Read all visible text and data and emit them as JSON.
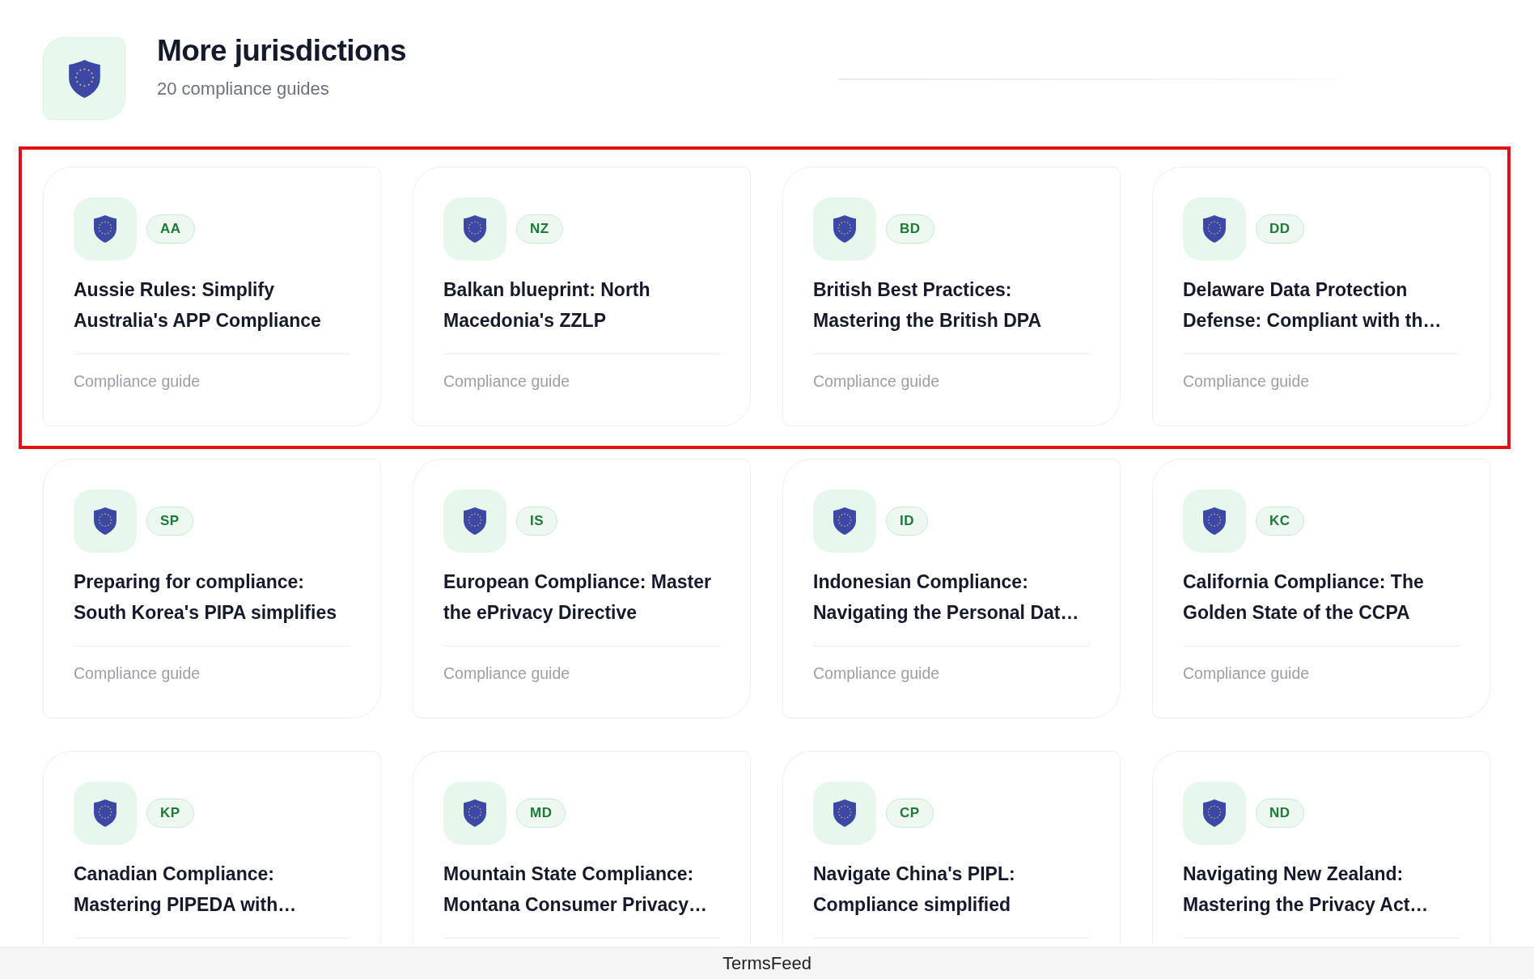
{
  "header": {
    "title": "More jurisdictions",
    "subtitle": "20 compliance guides"
  },
  "card_rows": [
    {
      "highlighted": true,
      "cards": [
        {
          "code": "AA",
          "title": "Aussie Rules: Simplify Australia's APP Compliance",
          "category": "Compliance guide"
        },
        {
          "code": "NZ",
          "title": "Balkan blueprint: North Macedonia's ZZLP",
          "category": "Compliance guide"
        },
        {
          "code": "BD",
          "title": "British Best Practices: Mastering the British DPA",
          "category": "Compliance guide"
        },
        {
          "code": "DD",
          "title": "Delaware Data Protection Defense: Compliant with th…",
          "category": "Compliance guide"
        }
      ]
    },
    {
      "highlighted": false,
      "cards": [
        {
          "code": "SP",
          "title": "Preparing for compliance: South Korea's PIPA simplifies",
          "category": "Compliance guide"
        },
        {
          "code": "IS",
          "title": "European Compliance: Master the ePrivacy Directive",
          "category": "Compliance guide"
        },
        {
          "code": "ID",
          "title": "Indonesian Compliance: Navigating the Personal Dat…",
          "category": "Compliance guide"
        },
        {
          "code": "KC",
          "title": "California Compliance: The Golden State of the CCPA",
          "category": "Compliance guide"
        }
      ]
    },
    {
      "highlighted": false,
      "cards": [
        {
          "code": "KP",
          "title": "Canadian Compliance: Mastering PIPEDA with…"
        },
        {
          "code": "MD",
          "title": "Mountain State Compliance: Montana Consumer Privacy…"
        },
        {
          "code": "CP",
          "title": "Navigate China's PIPL: Compliance simplified"
        },
        {
          "code": "ND",
          "title": "Navigating New Zealand: Mastering the Privacy Act…"
        }
      ]
    }
  ],
  "footer": {
    "text": "TermsFeed"
  }
}
